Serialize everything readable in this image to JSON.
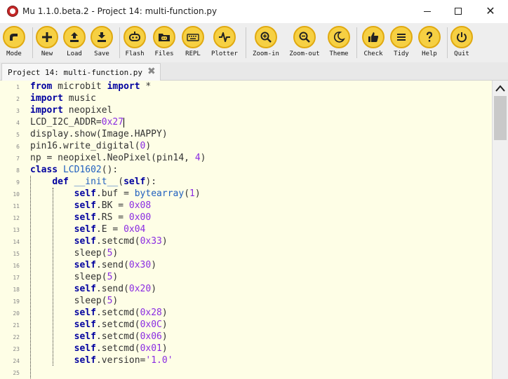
{
  "window": {
    "title": "Mu 1.1.0.beta.2 - Project 14:  multi-function.py",
    "minimize_label": "—",
    "close_label": "✕"
  },
  "colors": {
    "toolbar_button": "#f6d043",
    "toolbar_button_border": "#e0a910",
    "editor_background": "#fefee6",
    "keyword": "#00009f",
    "number": "#8a2be2"
  },
  "toolbar": {
    "buttons": [
      {
        "label": "Mode",
        "icon": "mode-icon"
      },
      {
        "label": "New",
        "icon": "plus-icon"
      },
      {
        "label": "Load",
        "icon": "upload-icon"
      },
      {
        "label": "Save",
        "icon": "download-icon"
      },
      {
        "label": "Flash",
        "icon": "microbit-icon"
      },
      {
        "label": "Files",
        "icon": "folder-icon"
      },
      {
        "label": "REPL",
        "icon": "keyboard-icon"
      },
      {
        "label": "Plotter",
        "icon": "waveform-icon"
      },
      {
        "label": "Zoom-in",
        "icon": "zoom-in-icon"
      },
      {
        "label": "Zoom-out",
        "icon": "zoom-out-icon"
      },
      {
        "label": "Theme",
        "icon": "moon-icon"
      },
      {
        "label": "Check",
        "icon": "thumbs-up-icon"
      },
      {
        "label": "Tidy",
        "icon": "hamburger-icon"
      },
      {
        "label": "Help",
        "icon": "question-icon"
      },
      {
        "label": "Quit",
        "icon": "power-icon"
      }
    ]
  },
  "tab": {
    "label": "Project 14: multi-function.py",
    "close_label": "✖"
  },
  "editor": {
    "line_numbers": [
      "1",
      "2",
      "3",
      "4",
      "5",
      "6",
      "7",
      "8",
      "9",
      "10",
      "11",
      "12",
      "13",
      "14",
      "15",
      "16",
      "17",
      "18",
      "19",
      "20",
      "21",
      "22",
      "23",
      "24",
      "25"
    ],
    "lines": [
      {
        "indent": "",
        "tokens": [
          {
            "t": "from",
            "c": "kw"
          },
          {
            "t": " microbit ",
            "c": ""
          },
          {
            "t": "import",
            "c": "kw"
          },
          {
            "t": " *",
            "c": ""
          }
        ]
      },
      {
        "indent": "",
        "tokens": [
          {
            "t": "import",
            "c": "kw"
          },
          {
            "t": " music",
            "c": ""
          }
        ]
      },
      {
        "indent": "",
        "tokens": [
          {
            "t": "import",
            "c": "kw"
          },
          {
            "t": " neopixel",
            "c": ""
          }
        ]
      },
      {
        "indent": "",
        "tokens": [
          {
            "t": "LCD_I2C_ADDR=",
            "c": ""
          },
          {
            "t": "0x27",
            "c": "num"
          }
        ]
      },
      {
        "indent": "",
        "tokens": [
          {
            "t": "display.show(Image.HAPPY)",
            "c": ""
          }
        ]
      },
      {
        "indent": "",
        "tokens": [
          {
            "t": "pin16.write_digital(",
            "c": ""
          },
          {
            "t": "0",
            "c": "num"
          },
          {
            "t": ")",
            "c": ""
          }
        ]
      },
      {
        "indent": "",
        "tokens": [
          {
            "t": "np = neopixel.NeoPixel(pin14, ",
            "c": ""
          },
          {
            "t": "4",
            "c": "num"
          },
          {
            "t": ")",
            "c": ""
          }
        ]
      },
      {
        "indent": "",
        "tokens": [
          {
            "t": "class",
            "c": "kw"
          },
          {
            "t": " ",
            "c": ""
          },
          {
            "t": "LCD1602",
            "c": "cls"
          },
          {
            "t": "():",
            "c": ""
          }
        ]
      },
      {
        "indent": "    ",
        "tokens": [
          {
            "t": "def",
            "c": "kw"
          },
          {
            "t": " ",
            "c": ""
          },
          {
            "t": "__init__",
            "c": "cls"
          },
          {
            "t": "(",
            "c": ""
          },
          {
            "t": "self",
            "c": "kw"
          },
          {
            "t": "):",
            "c": ""
          }
        ]
      },
      {
        "indent": "        ",
        "tokens": [
          {
            "t": "self",
            "c": "kw"
          },
          {
            "t": ".buf = ",
            "c": ""
          },
          {
            "t": "bytearray",
            "c": "cls"
          },
          {
            "t": "(",
            "c": ""
          },
          {
            "t": "1",
            "c": "num"
          },
          {
            "t": ")",
            "c": ""
          }
        ]
      },
      {
        "indent": "        ",
        "tokens": [
          {
            "t": "self",
            "c": "kw"
          },
          {
            "t": ".BK = ",
            "c": ""
          },
          {
            "t": "0x08",
            "c": "num"
          }
        ]
      },
      {
        "indent": "        ",
        "tokens": [
          {
            "t": "self",
            "c": "kw"
          },
          {
            "t": ".RS = ",
            "c": ""
          },
          {
            "t": "0x00",
            "c": "num"
          }
        ]
      },
      {
        "indent": "        ",
        "tokens": [
          {
            "t": "self",
            "c": "kw"
          },
          {
            "t": ".E = ",
            "c": ""
          },
          {
            "t": "0x04",
            "c": "num"
          }
        ]
      },
      {
        "indent": "        ",
        "tokens": [
          {
            "t": "self",
            "c": "kw"
          },
          {
            "t": ".setcmd(",
            "c": ""
          },
          {
            "t": "0x33",
            "c": "num"
          },
          {
            "t": ")",
            "c": ""
          }
        ]
      },
      {
        "indent": "        ",
        "tokens": [
          {
            "t": "sleep(",
            "c": ""
          },
          {
            "t": "5",
            "c": "num"
          },
          {
            "t": ")",
            "c": ""
          }
        ]
      },
      {
        "indent": "        ",
        "tokens": [
          {
            "t": "self",
            "c": "kw"
          },
          {
            "t": ".send(",
            "c": ""
          },
          {
            "t": "0x30",
            "c": "num"
          },
          {
            "t": ")",
            "c": ""
          }
        ]
      },
      {
        "indent": "        ",
        "tokens": [
          {
            "t": "sleep(",
            "c": ""
          },
          {
            "t": "5",
            "c": "num"
          },
          {
            "t": ")",
            "c": ""
          }
        ]
      },
      {
        "indent": "        ",
        "tokens": [
          {
            "t": "self",
            "c": "kw"
          },
          {
            "t": ".send(",
            "c": ""
          },
          {
            "t": "0x20",
            "c": "num"
          },
          {
            "t": ")",
            "c": ""
          }
        ]
      },
      {
        "indent": "        ",
        "tokens": [
          {
            "t": "sleep(",
            "c": ""
          },
          {
            "t": "5",
            "c": "num"
          },
          {
            "t": ")",
            "c": ""
          }
        ]
      },
      {
        "indent": "        ",
        "tokens": [
          {
            "t": "self",
            "c": "kw"
          },
          {
            "t": ".setcmd(",
            "c": ""
          },
          {
            "t": "0x28",
            "c": "num"
          },
          {
            "t": ")",
            "c": ""
          }
        ]
      },
      {
        "indent": "        ",
        "tokens": [
          {
            "t": "self",
            "c": "kw"
          },
          {
            "t": ".setcmd(",
            "c": ""
          },
          {
            "t": "0x0C",
            "c": "num"
          },
          {
            "t": ")",
            "c": ""
          }
        ]
      },
      {
        "indent": "        ",
        "tokens": [
          {
            "t": "self",
            "c": "kw"
          },
          {
            "t": ".setcmd(",
            "c": ""
          },
          {
            "t": "0x06",
            "c": "num"
          },
          {
            "t": ")",
            "c": ""
          }
        ]
      },
      {
        "indent": "        ",
        "tokens": [
          {
            "t": "self",
            "c": "kw"
          },
          {
            "t": ".setcmd(",
            "c": ""
          },
          {
            "t": "0x01",
            "c": "num"
          },
          {
            "t": ")",
            "c": ""
          }
        ]
      },
      {
        "indent": "        ",
        "tokens": [
          {
            "t": "self",
            "c": "kw"
          },
          {
            "t": ".version=",
            "c": ""
          },
          {
            "t": "'1.0'",
            "c": "str"
          }
        ]
      },
      {
        "indent": "",
        "tokens": []
      }
    ]
  }
}
